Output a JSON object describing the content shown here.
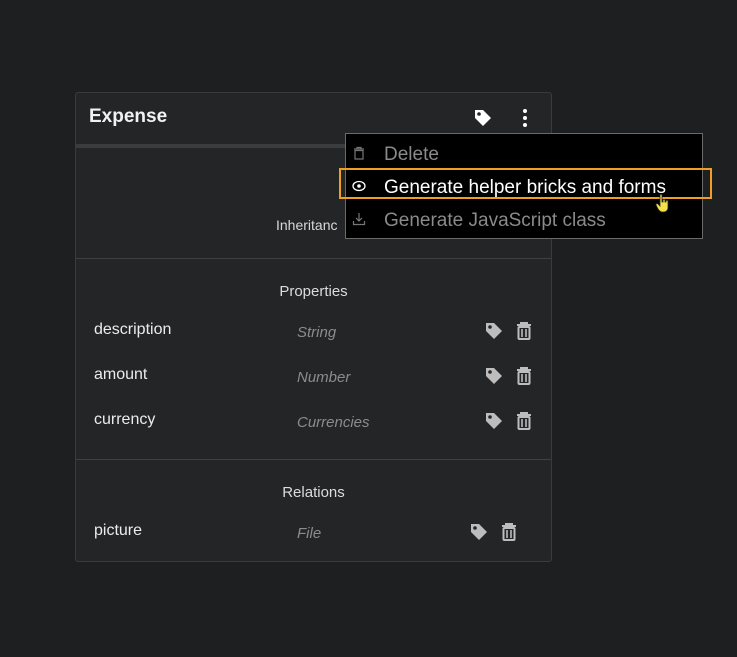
{
  "entity": {
    "title": "Expense",
    "inheritance_label": "Inheritanc",
    "properties_title": "Properties",
    "properties": [
      {
        "name": "description",
        "type": "String"
      },
      {
        "name": "amount",
        "type": "Number"
      },
      {
        "name": "currency",
        "type": "Currencies"
      }
    ],
    "relations_title": "Relations",
    "relations": [
      {
        "name": "picture",
        "type": "File"
      }
    ]
  },
  "context_menu": {
    "items": [
      {
        "label": "Delete",
        "icon": "trash-icon",
        "enabled": false
      },
      {
        "label": "Generate helper bricks and forms",
        "icon": "generate-icon",
        "enabled": true
      },
      {
        "label": "Generate JavaScript class",
        "icon": "download-icon",
        "enabled": false
      }
    ]
  },
  "colors": {
    "background": "#1e1f20",
    "card": "#242526",
    "highlight": "#f0a020",
    "menu": "#000000"
  }
}
